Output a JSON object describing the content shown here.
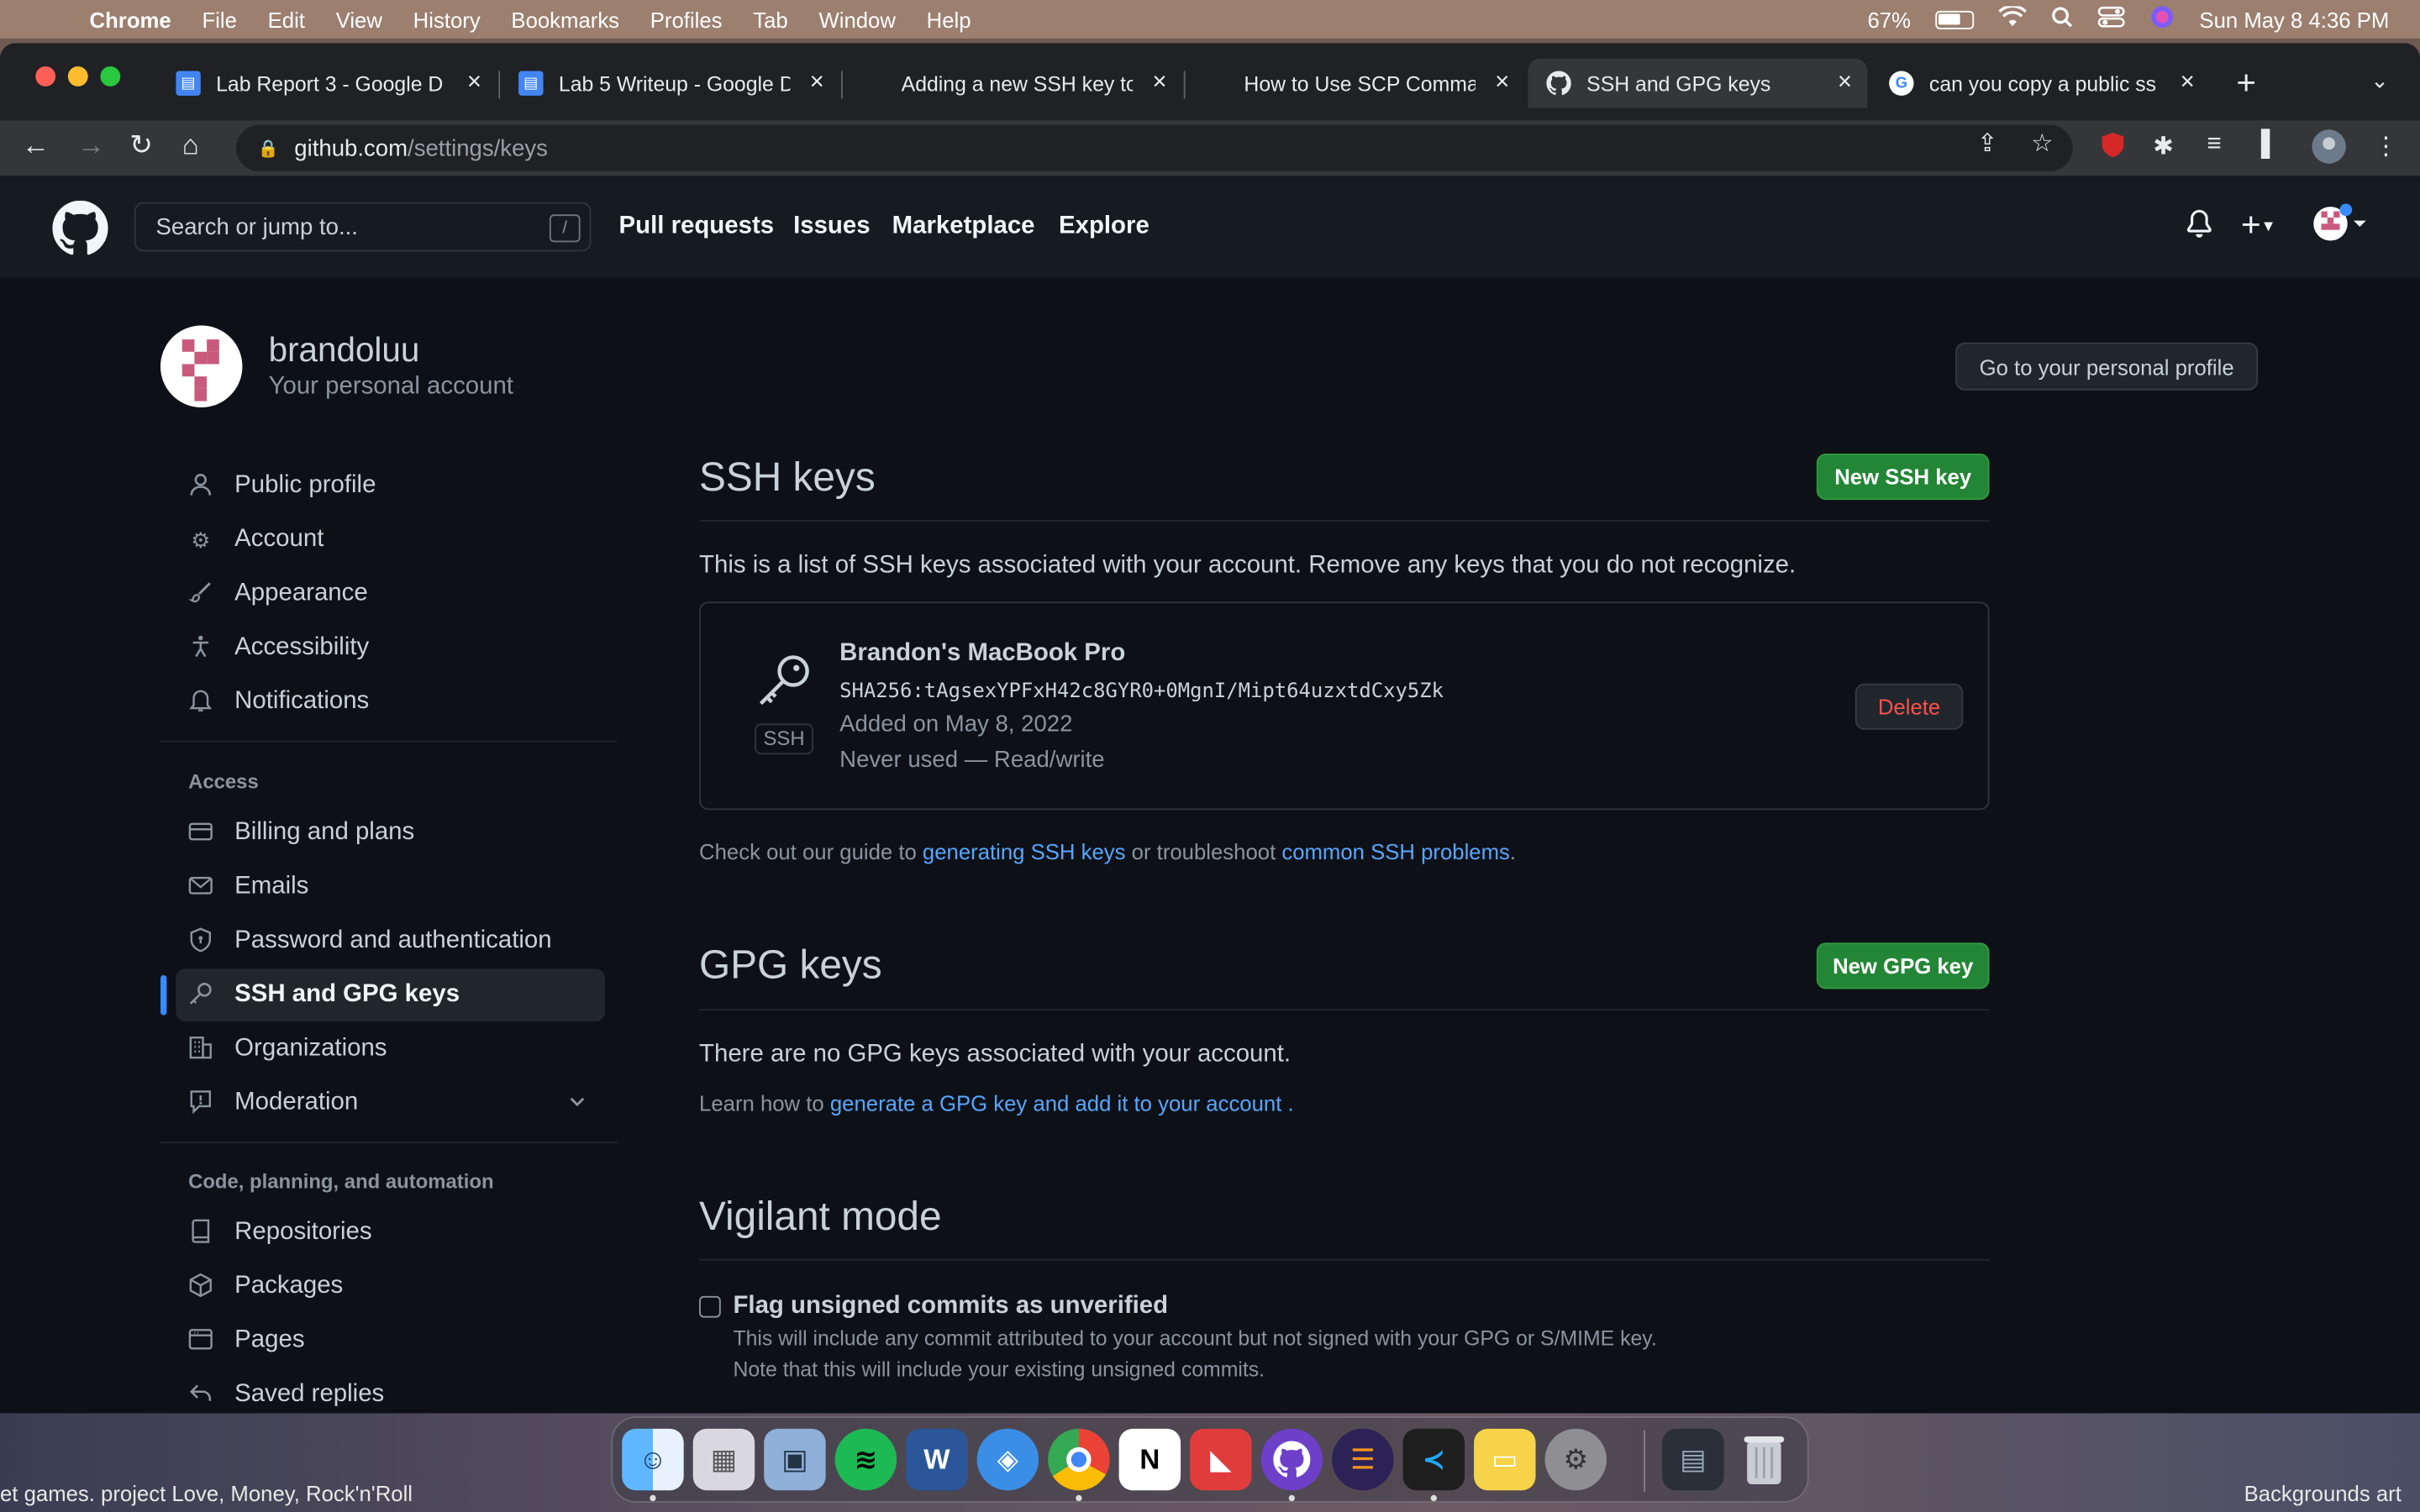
{
  "menubar": {
    "app": "Chrome",
    "items": [
      "File",
      "Edit",
      "View",
      "History",
      "Bookmarks",
      "Profiles",
      "Tab",
      "Window",
      "Help"
    ],
    "battery": "67%",
    "datetime": "Sun May 8  4:36 PM"
  },
  "tabs": [
    {
      "title": "Lab Report 3 - Google D",
      "icon": "google-docs-icon"
    },
    {
      "title": "Lab 5 Writeup - Google D",
      "icon": "google-docs-icon"
    },
    {
      "title": "Adding a new SSH key to",
      "icon": "page-icon"
    },
    {
      "title": "How to Use SCP Comma",
      "icon": "page-icon"
    },
    {
      "title": "SSH and GPG keys",
      "icon": "github-icon"
    },
    {
      "title": "can you copy a public ss",
      "icon": "google-icon"
    }
  ],
  "omnibox": {
    "host": "github.com",
    "path": "/settings/keys"
  },
  "gh_header": {
    "search_placeholder": "Search or jump to...",
    "slash": "/",
    "nav": [
      "Pull requests",
      "Issues",
      "Marketplace",
      "Explore"
    ]
  },
  "user": {
    "name": "brandoluu",
    "subtitle": "Your personal account",
    "profile_button": "Go to your personal profile"
  },
  "sidebar": {
    "items": [
      {
        "label": "Public profile",
        "icon": "person-icon"
      },
      {
        "label": "Account",
        "icon": "gear-icon"
      },
      {
        "label": "Appearance",
        "icon": "paintbrush-icon"
      },
      {
        "label": "Accessibility",
        "icon": "accessibility-icon"
      },
      {
        "label": "Notifications",
        "icon": "bell-icon"
      }
    ],
    "access_heading": "Access",
    "access_items": [
      {
        "label": "Billing and plans",
        "icon": "credit-card-icon"
      },
      {
        "label": "Emails",
        "icon": "mail-icon"
      },
      {
        "label": "Password and authentication",
        "icon": "shield-icon"
      },
      {
        "label": "SSH and GPG keys",
        "icon": "key-icon"
      },
      {
        "label": "Organizations",
        "icon": "organization-icon"
      },
      {
        "label": "Moderation",
        "icon": "report-icon"
      }
    ],
    "code_heading": "Code, planning, and automation",
    "code_items": [
      {
        "label": "Repositories",
        "icon": "repo-icon"
      },
      {
        "label": "Packages",
        "icon": "package-icon"
      },
      {
        "label": "Pages",
        "icon": "browser-icon"
      },
      {
        "label": "Saved replies",
        "icon": "reply-icon"
      }
    ]
  },
  "ssh": {
    "title": "SSH keys",
    "new_button": "New SSH key",
    "description": "This is a list of SSH keys associated with your account. Remove any keys that you do not recognize.",
    "key": {
      "name": "Brandon's MacBook Pro",
      "fingerprint": "SHA256:tAgsexYPFxH42c8GYR0+0MgnI/Mipt64uzxtdCxy5Zk",
      "added": "Added on May 8, 2022",
      "usage": "Never used — Read/write",
      "badge": "SSH",
      "delete_button": "Delete"
    },
    "guide_prefix": "Check out our guide to ",
    "guide_link": "generating SSH keys",
    "guide_mid": " or troubleshoot ",
    "guide_link2": "common SSH problems",
    "guide_suffix": "."
  },
  "gpg": {
    "title": "GPG keys",
    "new_button": "New GPG key",
    "empty": "There are no GPG keys associated with your account.",
    "learn_prefix": "Learn how to ",
    "learn_link": "generate a GPG key and add it to your account",
    "learn_suffix": " ."
  },
  "vigilant": {
    "title": "Vigilant mode",
    "checkbox_label": "Flag unsigned commits as unverified",
    "note1": "This will include any commit attributed to your account but not signed with your GPG or S/MIME key.",
    "note2": "Note that this will include your existing unsigned commits."
  },
  "desktop": {
    "left_text": "et games.  project Love, Money, Rock'n'Roll",
    "right_text": "Backgrounds art"
  },
  "dock": [
    "finder-icon",
    "launchpad-icon",
    "preview-icon",
    "spotify-icon",
    "word-icon",
    "safari-icon",
    "chrome-icon",
    "notion-icon",
    "bear-icon",
    "github-desktop-icon",
    "eclipse-icon",
    "vscode-icon",
    "notes-icon",
    "system-preferences-icon",
    "screenshot-icon",
    "trash-icon"
  ],
  "colors": {
    "bg": "#0d1117",
    "header": "#161b22",
    "accent_green": "#238636",
    "link": "#58a6ff",
    "danger": "#f85149"
  }
}
